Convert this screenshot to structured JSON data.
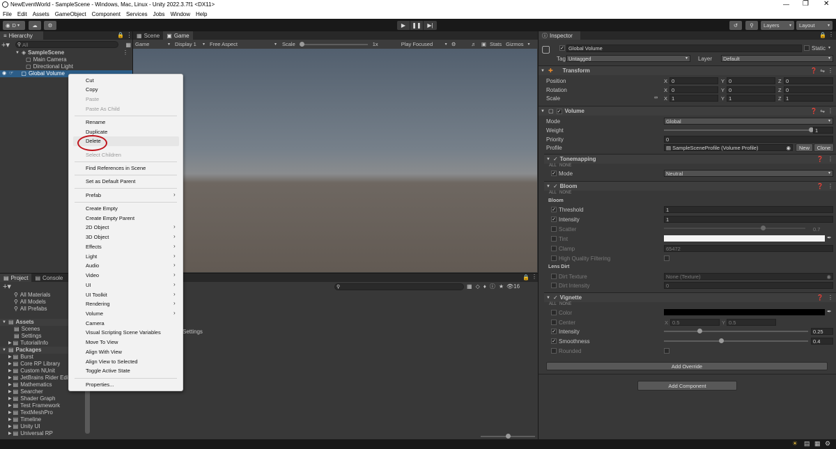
{
  "window": {
    "title": "NewEventWorld - SampleScene - Windows, Mac, Linux - Unity 2022.3.7f1 <DX11>"
  },
  "menu": [
    "File",
    "Edit",
    "Assets",
    "GameObject",
    "Component",
    "Services",
    "Jobs",
    "Window",
    "Help"
  ],
  "toolbar": {
    "account": "D",
    "layers": "Layers",
    "layout": "Layout"
  },
  "hierarchy": {
    "tab": "Hierarchy",
    "search_placeholder": "All",
    "scene": "SampleScene",
    "items": [
      "Main Camera",
      "Directional Light",
      "Global Volume"
    ]
  },
  "gameview": {
    "tabs": [
      "Scene",
      "Game"
    ],
    "display_mode": "Game",
    "display": "Display 1",
    "aspect": "Free Aspect",
    "scale_label": "Scale",
    "scale_value": "1x",
    "play_mode": "Play Focused",
    "stats": "Stats",
    "gizmos": "Gizmos"
  },
  "context_menu": {
    "cut": "Cut",
    "copy": "Copy",
    "paste": "Paste",
    "paste_as_child": "Paste As Child",
    "rename": "Rename",
    "duplicate": "Duplicate",
    "delete": "Delete",
    "select_children": "Select Children",
    "find_references": "Find References in Scene",
    "set_default_parent": "Set as Default Parent",
    "prefab": "Prefab",
    "create_empty": "Create Empty",
    "create_empty_parent": "Create Empty Parent",
    "obj_2d": "2D Object",
    "obj_3d": "3D Object",
    "effects": "Effects",
    "light": "Light",
    "audio": "Audio",
    "video": "Video",
    "ui": "UI",
    "ui_toolkit": "UI Toolkit",
    "rendering": "Rendering",
    "volume": "Volume",
    "camera": "Camera",
    "visual_scripting": "Visual Scripting Scene Variables",
    "move_to_view": "Move To View",
    "align_with_view": "Align With View",
    "align_view_to_selected": "Align View to Selected",
    "toggle_active": "Toggle Active State",
    "properties": "Properties..."
  },
  "project": {
    "tabs": [
      "Project",
      "Console"
    ],
    "favorites": [
      "All Materials",
      "All Models",
      "All Prefabs"
    ],
    "assets_label": "Assets",
    "assets": [
      "Scenes",
      "Settings",
      "TutorialInfo"
    ],
    "packages_label": "Packages",
    "packages": [
      "Burst",
      "Core RP Library",
      "Custom NUnit",
      "JetBrains Rider Edit",
      "Mathematics",
      "Searcher",
      "Shader Graph",
      "Test Framework",
      "TextMeshPro",
      "Timeline",
      "Unity UI",
      "Universal RP"
    ],
    "right_item": "Settings",
    "hidden_count": "16"
  },
  "inspector": {
    "tab": "Inspector",
    "object_name": "Global Volume",
    "static_label": "Static",
    "tag_label": "Tag",
    "tag": "Untagged",
    "layer_label": "Layer",
    "layer": "Default",
    "transform": {
      "title": "Transform",
      "position_label": "Position",
      "rotation_label": "Rotation",
      "scale_label": "Scale",
      "x": "X",
      "y": "Y",
      "z": "Z",
      "position": [
        "0",
        "0",
        "0"
      ],
      "rotation": [
        "0",
        "0",
        "0"
      ],
      "scale": [
        "1",
        "1",
        "1"
      ]
    },
    "volume": {
      "title": "Volume",
      "mode_label": "Mode",
      "mode": "Global",
      "weight_label": "Weight",
      "weight": "1",
      "weight_fraction": 1.0,
      "priority_label": "Priority",
      "priority": "0",
      "profile_label": "Profile",
      "profile": "SampleSceneProfile (Volume Profile)",
      "new_button": "New",
      "clone_button": "Clone"
    },
    "all": "ALL",
    "none": "NONE",
    "tonemapping": {
      "title": "Tonemapping",
      "mode_label": "Mode",
      "mode": "Neutral"
    },
    "bloom": {
      "title": "Bloom",
      "section_bloom": "Bloom",
      "threshold_label": "Threshold",
      "threshold": "1",
      "intensity_label": "Intensity",
      "intensity": "1",
      "scatter_label": "Scatter",
      "scatter": "0.7",
      "scatter_fraction": 0.7,
      "tint_label": "Tint",
      "clamp_label": "Clamp",
      "clamp": "65472",
      "hq_label": "High Quality Filtering",
      "section_lens": "Lens Dirt",
      "dirt_texture_label": "Dirt Texture",
      "dirt_texture": "None (Texture)",
      "dirt_intensity_label": "Dirt Intensity",
      "dirt_intensity": "0"
    },
    "vignette": {
      "title": "Vignette",
      "color_label": "Color",
      "center_label": "Center",
      "center_x": "0.5",
      "center_y": "0.5",
      "intensity_label": "Intensity",
      "intensity": "0.25",
      "intensity_fraction": 0.25,
      "smoothness_label": "Smoothness",
      "smoothness": "0.4",
      "smoothness_fraction": 0.4,
      "rounded_label": "Rounded"
    },
    "add_override": "Add Override",
    "add_component": "Add Component"
  },
  "colors": {
    "selection": "#2c5d87",
    "annotation": "#c0141c",
    "panel": "#383838"
  }
}
